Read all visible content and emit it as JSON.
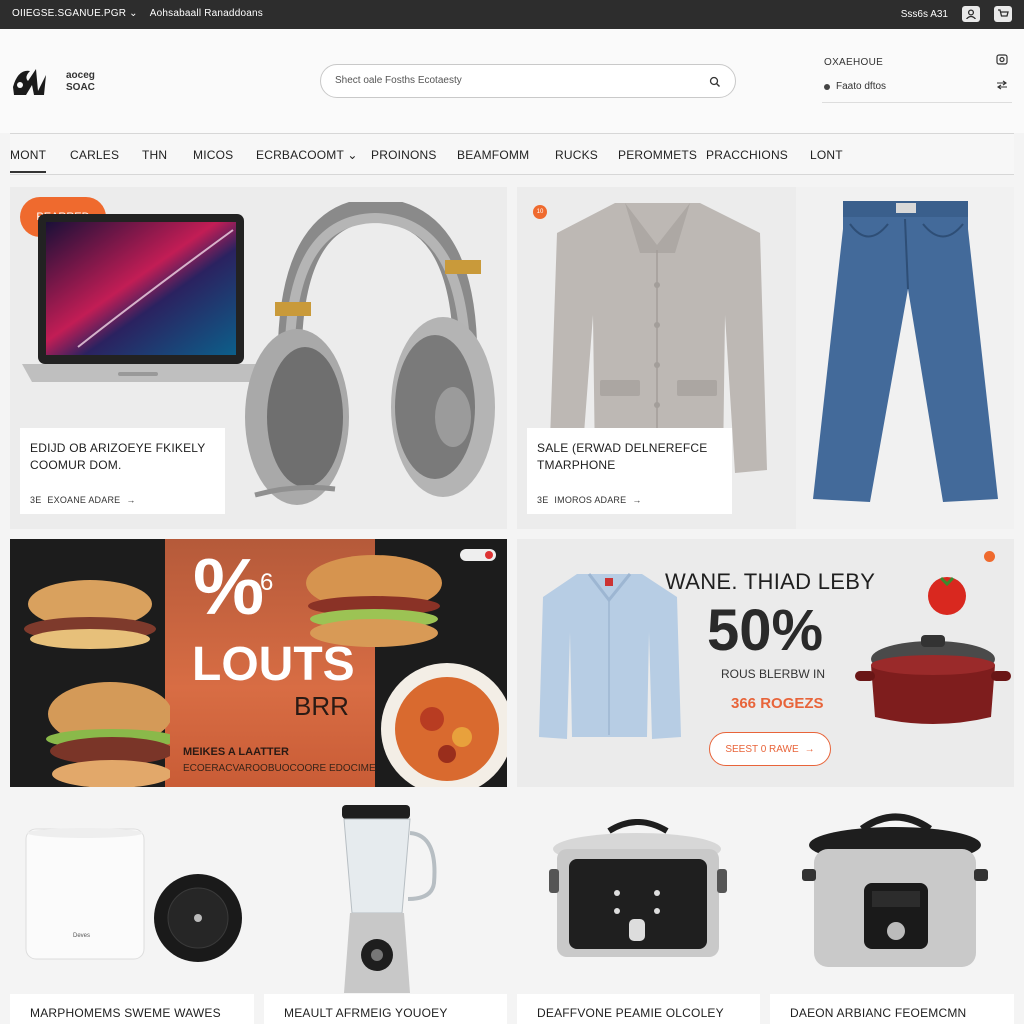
{
  "topbar": {
    "left_1": "OIIEGSE.SGANUE.PGR",
    "left_chevron": "⌄",
    "left_2": "Aohsabaall Ranaddoans",
    "right_text": "Sss6s A31"
  },
  "header": {
    "logo_line1": "aoceg",
    "logo_line2": "SOAC",
    "search_placeholder": "Shect oale Fosths Ecotaesty",
    "account_title": "OXAEHOUE",
    "account_sub": "Faato dftos"
  },
  "nav": [
    "MONT",
    "CARLES",
    "THN",
    "MICOS",
    "ECRBACOOMT",
    "PROINONS",
    "BEAMFOMM",
    "RUCKS",
    "PEROMMETS",
    "PRACCHIONS",
    "LONT"
  ],
  "cards": {
    "tech": {
      "badge": "PEARRED",
      "title": "EDIJD OB ARIZOEYE FKIKELY COOMUR DOM.",
      "cta": "EXOANE ADARE",
      "cta_prefix": "3E"
    },
    "fashion": {
      "badge": "10",
      "title": "SALE (ERWAD DELNEREFCE TMARPHONE",
      "cta": "IMOROS ADARE",
      "cta_prefix": "3E"
    },
    "food": {
      "percent": "%",
      "small_digit": "6",
      "title": "LOUTS",
      "sub": "BRR",
      "tag1": "MEIKES A LAATTER",
      "tag2": "ECOERACVAROOBUOCOORE EDOCIME"
    },
    "promo": {
      "headline": "WANE. THIAD LEBY",
      "percent": "50%",
      "sub": "ROUS BLERBW IN",
      "price": "366 ROGEZS",
      "button": "SEEST 0 RAWE"
    },
    "p1": {
      "label": "MARPHOMEMS SWEME WAWES",
      "device_label": "Deves"
    },
    "p2": {
      "label": "MEAULT AFRMEIG YOUOEY"
    },
    "p3": {
      "label": "DEAFFVONE PEAMIE OLCOLEY"
    },
    "p4": {
      "label": "DAEON ARBIANC FEOEMCMN"
    }
  },
  "colors": {
    "accent": "#ef6a2e",
    "dark": "#2d2d2d",
    "promo_price": "#e8643a"
  }
}
